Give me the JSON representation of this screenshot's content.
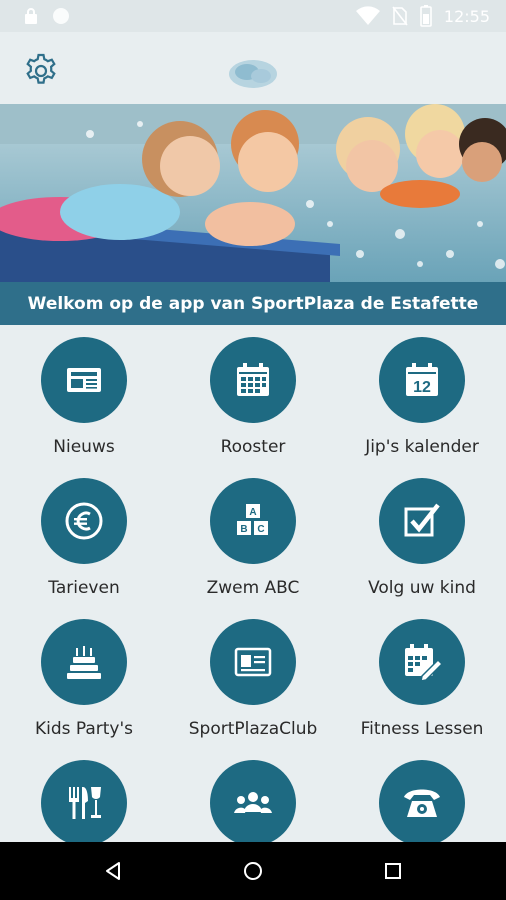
{
  "status_bar": {
    "time": "12:55",
    "icons": [
      "lock-icon",
      "circle-icon",
      "wifi-icon",
      "no-sim-icon",
      "battery-icon"
    ]
  },
  "app_bar": {
    "settings_icon": "gear-icon",
    "logo": "sportplaza-logo"
  },
  "banner": {
    "title": "Welkom op de app van SportPlaza de Estafette"
  },
  "menu": {
    "items": [
      {
        "label": "Nieuws",
        "icon": "newspaper-icon"
      },
      {
        "label": "Rooster",
        "icon": "calendar-grid-icon"
      },
      {
        "label": "Jip's kalender",
        "icon": "calendar-12-icon"
      },
      {
        "label": "Tarieven",
        "icon": "euro-icon"
      },
      {
        "label": "Zwem ABC",
        "icon": "abc-blocks-icon"
      },
      {
        "label": "Volg uw kind",
        "icon": "checkbox-icon"
      },
      {
        "label": "Kids Party's",
        "icon": "cake-icon"
      },
      {
        "label": "SportPlazaClub",
        "icon": "member-card-icon"
      },
      {
        "label": "Fitness Lessen",
        "icon": "calendar-pen-icon"
      },
      {
        "label": "",
        "icon": "restaurant-icon"
      },
      {
        "label": "",
        "icon": "group-icon"
      },
      {
        "label": "",
        "icon": "phone-icon"
      }
    ]
  },
  "nav_bar": {
    "icons": [
      "back-icon",
      "home-icon",
      "recents-icon"
    ]
  },
  "colors": {
    "accent": "#1e6a82",
    "banner": "#2f6f8a",
    "background": "#e8eef0"
  }
}
